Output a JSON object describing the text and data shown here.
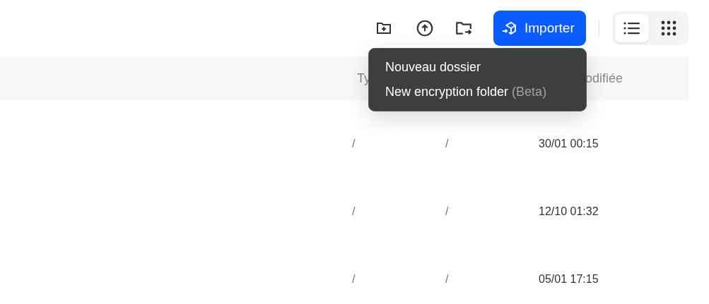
{
  "toolbar": {
    "import_button": {
      "label": "Importer"
    },
    "views": [
      {
        "kind": "list",
        "selected": true
      },
      {
        "kind": "grid",
        "selected": false
      }
    ]
  },
  "dropdown_menu": {
    "items": [
      {
        "label": "Nouveau dossier"
      },
      {
        "label": "New encryption folder",
        "note": "(Beta)"
      }
    ]
  },
  "table": {
    "columns": [
      {
        "label": "Ty"
      },
      {
        "label": "odifiée"
      }
    ],
    "rows": [
      {
        "type": "/",
        "size": "/",
        "modified": "30/01 00:15"
      },
      {
        "type": "/",
        "size": "/",
        "modified": "12/10 01:32"
      },
      {
        "type": "/",
        "size": "/",
        "modified": "05/01 17:15"
      }
    ]
  }
}
